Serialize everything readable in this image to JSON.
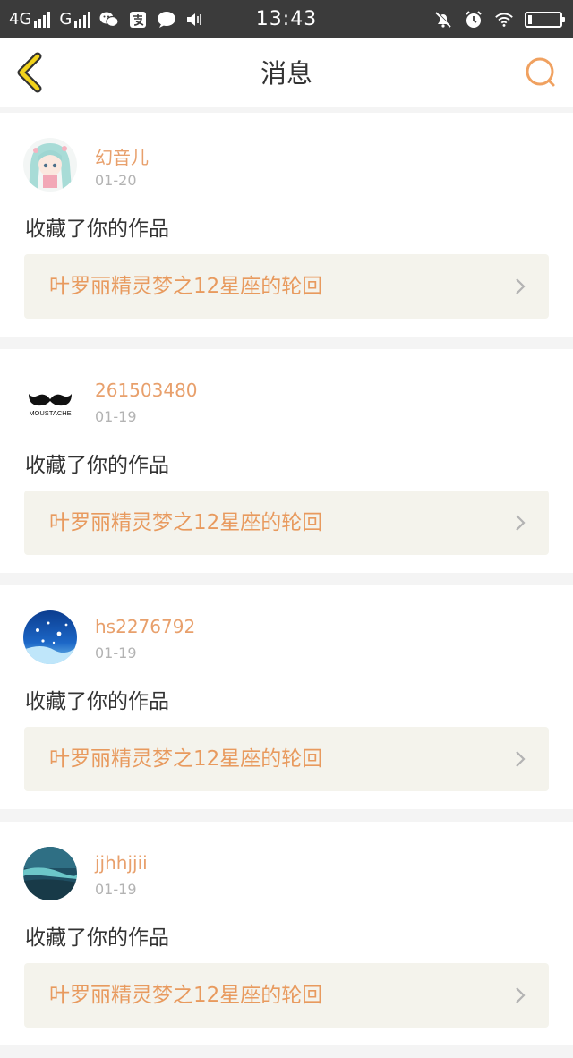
{
  "status_bar": {
    "network1": "4G",
    "network2": "G",
    "time": "13:43"
  },
  "header": {
    "title": "消息",
    "back_icon": "chevron-left-icon",
    "search_icon": "search-icon"
  },
  "colors": {
    "accent": "#e8a06c",
    "work_bg": "#f4f3ec",
    "status_bar_bg": "#3b3b3b"
  },
  "messages": [
    {
      "user": "幻音儿",
      "date": "01-20",
      "action": "收藏了你的作品",
      "work": "叶罗丽精灵梦之12星座的轮回",
      "avatar": "anime-girl-avatar"
    },
    {
      "user": "261503480",
      "date": "01-19",
      "action": "收藏了你的作品",
      "work": "叶罗丽精灵梦之12星座的轮回",
      "avatar": "moustache-avatar",
      "avatar_text": "MOUSTACHE"
    },
    {
      "user": "hs2276792",
      "date": "01-19",
      "action": "收藏了你的作品",
      "work": "叶罗丽精灵梦之12星座的轮回",
      "avatar": "blue-snowflake-avatar"
    },
    {
      "user": "jjhhjjii",
      "date": "01-19",
      "action": "收藏了你的作品",
      "work": "叶罗丽精灵梦之12星座的轮回",
      "avatar": "ocean-aerial-avatar"
    }
  ]
}
